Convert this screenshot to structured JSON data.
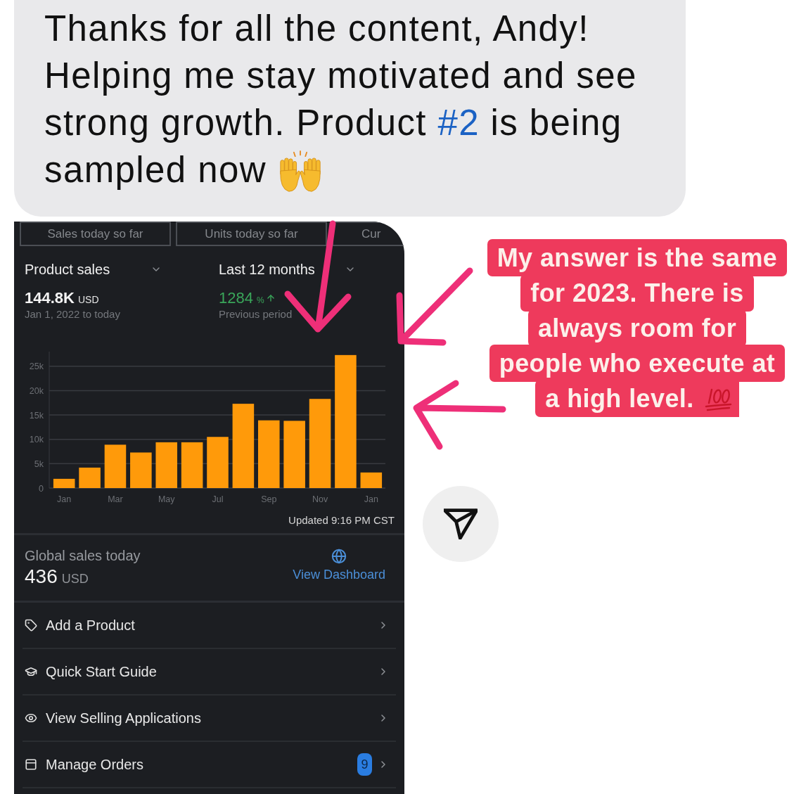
{
  "message": {
    "text_before": "Thanks for all the content, Andy! Helping me stay motivated and see strong growth. Product ",
    "link": "#2",
    "text_after": " is being",
    "last_line": "sampled now"
  },
  "dashboard": {
    "summary_cards": [
      {
        "label": "Sales today so far"
      },
      {
        "label": "Units today so far"
      },
      {
        "label": "Cur"
      }
    ],
    "metric_dropdown": {
      "label": "Product sales"
    },
    "period_dropdown": {
      "label": "Last 12 months"
    },
    "total": {
      "value": "144.8K",
      "unit": "USD",
      "range": "Jan 1, 2022 to today"
    },
    "change": {
      "value": "1284",
      "unit": "%",
      "caption": "Previous period"
    },
    "chart_data": {
      "type": "bar",
      "categories": [
        "Jan",
        null,
        "Mar",
        null,
        "May",
        null,
        "Jul",
        null,
        "Sep",
        null,
        "Nov",
        null,
        "Jan"
      ],
      "values": [
        1900,
        4200,
        8900,
        7300,
        9400,
        9400,
        10500,
        17300,
        13900,
        13800,
        18300,
        27300,
        3200
      ],
      "yticks": [
        {
          "value": 0,
          "label": "0"
        },
        {
          "value": 5000,
          "label": "5k"
        },
        {
          "value": 10000,
          "label": "10k"
        },
        {
          "value": 15000,
          "label": "15k"
        },
        {
          "value": 20000,
          "label": "20k"
        },
        {
          "value": 25000,
          "label": "25k"
        }
      ],
      "ylim": [
        0,
        28000
      ],
      "grid": true
    },
    "updated": "Updated 9:16 PM CST",
    "global_sales": {
      "label": "Global sales today",
      "value": "436",
      "unit": "USD",
      "link": "View Dashboard"
    },
    "menu_items": [
      {
        "label": "Add a Product"
      },
      {
        "label": "Quick Start Guide"
      },
      {
        "label": "View Selling Applications"
      },
      {
        "label": "Manage Orders",
        "badge": "9"
      }
    ]
  },
  "caption": {
    "lines": [
      "My answer is the same",
      "for 2023. There is",
      "always room for",
      "people who execute at",
      "a high level."
    ]
  }
}
